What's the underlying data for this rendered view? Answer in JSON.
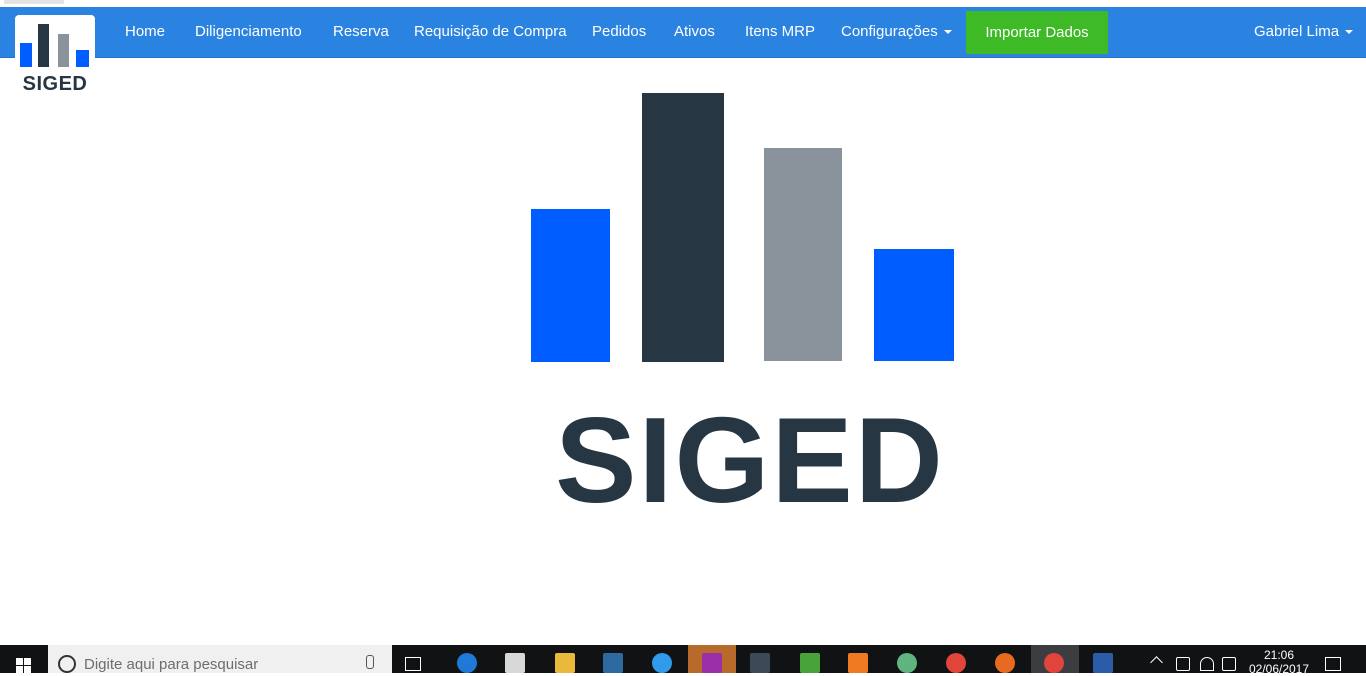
{
  "navbar": {
    "brand": "SIGED",
    "items": [
      {
        "label": "Home"
      },
      {
        "label": "Diligenciamento"
      },
      {
        "label": "Reserva"
      },
      {
        "label": "Requisição de Compra"
      },
      {
        "label": "Pedidos"
      },
      {
        "label": "Ativos"
      },
      {
        "label": "Itens MRP"
      },
      {
        "label": "Configurações"
      }
    ],
    "import_label": "Importar Dados",
    "user_label": "Gabriel Lima"
  },
  "hero": {
    "logo_text": "SIGED",
    "bar_colors": [
      "#005dff",
      "#263643",
      "#8a939c",
      "#005dff"
    ]
  },
  "taskbar": {
    "search_placeholder": "Digite aqui para pesquisar",
    "time": "21:06",
    "date": "02/06/2017",
    "apps": [
      "edge-icon",
      "store-icon",
      "explorer-icon",
      "sql-icon",
      "ie-icon",
      "phpstorm-icon",
      "video-icon",
      "camtasia-icon",
      "xampp-icon",
      "atom-icon",
      "chrome-icon",
      "firefox-icon",
      "chrome-icon",
      "word-icon"
    ]
  },
  "colors": {
    "navbar": "#2b83e1",
    "import_button": "#3dba25",
    "brand_dark": "#263643",
    "brand_blue": "#005dff",
    "brand_gray": "#8a939c"
  }
}
